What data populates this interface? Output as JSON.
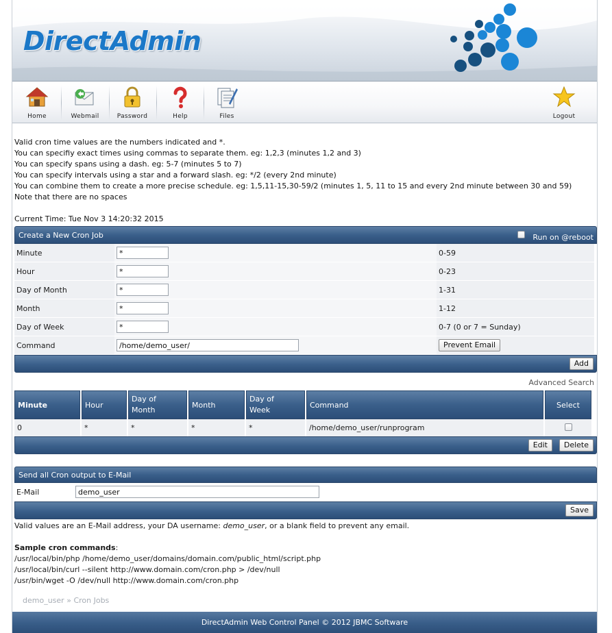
{
  "brand": {
    "logo_text": "DirectAdmin"
  },
  "toolbar": {
    "items": [
      {
        "label": "Home",
        "icon": "home-icon"
      },
      {
        "label": "Webmail",
        "icon": "webmail-icon"
      },
      {
        "label": "Password",
        "icon": "lock-icon"
      },
      {
        "label": "Help",
        "icon": "question-icon"
      },
      {
        "label": "Files",
        "icon": "files-icon"
      },
      {
        "label": "Logout",
        "icon": "star-icon"
      }
    ]
  },
  "info": {
    "lines": [
      "Valid cron time values are the numbers indicated and *.",
      "You can specifiy exact times using commas to separate them. eg: 1,2,3 (minutes 1,2 and 3)",
      "You can specify spans using a dash. eg: 5-7 (minutes 5 to 7)",
      "You can specify intervals using a star and a forward slash. eg: */2 (every 2nd minute)",
      "You can combine them to create a more precise schedule. eg: 1,5,11-15,30-59/2 (minutes 1, 5, 11 to 15 and every 2nd minute between 30 and 59)",
      "Note that there are no spaces"
    ],
    "current_time": "Current Time: Tue Nov 3 14:20:32 2015"
  },
  "create": {
    "title": "Create a New Cron Job",
    "reboot_label": "Run on @reboot",
    "fields": [
      {
        "label": "Minute",
        "value": "*",
        "range": "0-59"
      },
      {
        "label": "Hour",
        "value": "*",
        "range": "0-23"
      },
      {
        "label": "Day of Month",
        "value": "*",
        "range": "1-31"
      },
      {
        "label": "Month",
        "value": "*",
        "range": "1-12"
      },
      {
        "label": "Day of Week",
        "value": "*",
        "range": "0-7 (0 or 7 = Sunday)"
      }
    ],
    "command_label": "Command",
    "command_value": "/home/demo_user/",
    "prevent_email_label": "Prevent Email",
    "add_label": "Add"
  },
  "advanced_search": "Advanced Search",
  "jobs": {
    "headers": {
      "minute": "Minute",
      "hour": "Hour",
      "dom_1": "Day of",
      "dom_2": "Month",
      "month": "Month",
      "dow_1": "Day of",
      "dow_2": "Week",
      "command": "Command",
      "select": "Select"
    },
    "rows": [
      {
        "minute": "0",
        "hour": "*",
        "dom": "*",
        "month": "*",
        "dow": "*",
        "command": "/home/demo_user/runprogram"
      }
    ],
    "edit_label": "Edit",
    "delete_label": "Delete"
  },
  "email": {
    "title": "Send all Cron output to E-Mail",
    "label": "E-Mail",
    "value": "demo_user",
    "save_label": "Save",
    "note_prefix": "Valid values are an E-Mail address, your DA username: ",
    "note_user": "demo_user",
    "note_suffix": ", or a blank field to prevent any email."
  },
  "samples": {
    "title": "Sample cron commands",
    "colon": ":",
    "lines": [
      "/usr/local/bin/php /home/demo_user/domains/domain.com/public_html/script.php",
      "/usr/local/bin/curl --silent http://www.domain.com/cron.php > /dev/null",
      "/usr/bin/wget -O /dev/null http://www.domain.com/cron.php"
    ]
  },
  "breadcrumb": {
    "user": "demo_user",
    "sep": " » ",
    "page": "Cron Jobs"
  },
  "footer": {
    "text": "DirectAdmin Web Control Panel © 2012 JBMC Software"
  },
  "colors": {
    "header_blue": "#3a5f8a",
    "logo_blue": "#1b78c8"
  }
}
